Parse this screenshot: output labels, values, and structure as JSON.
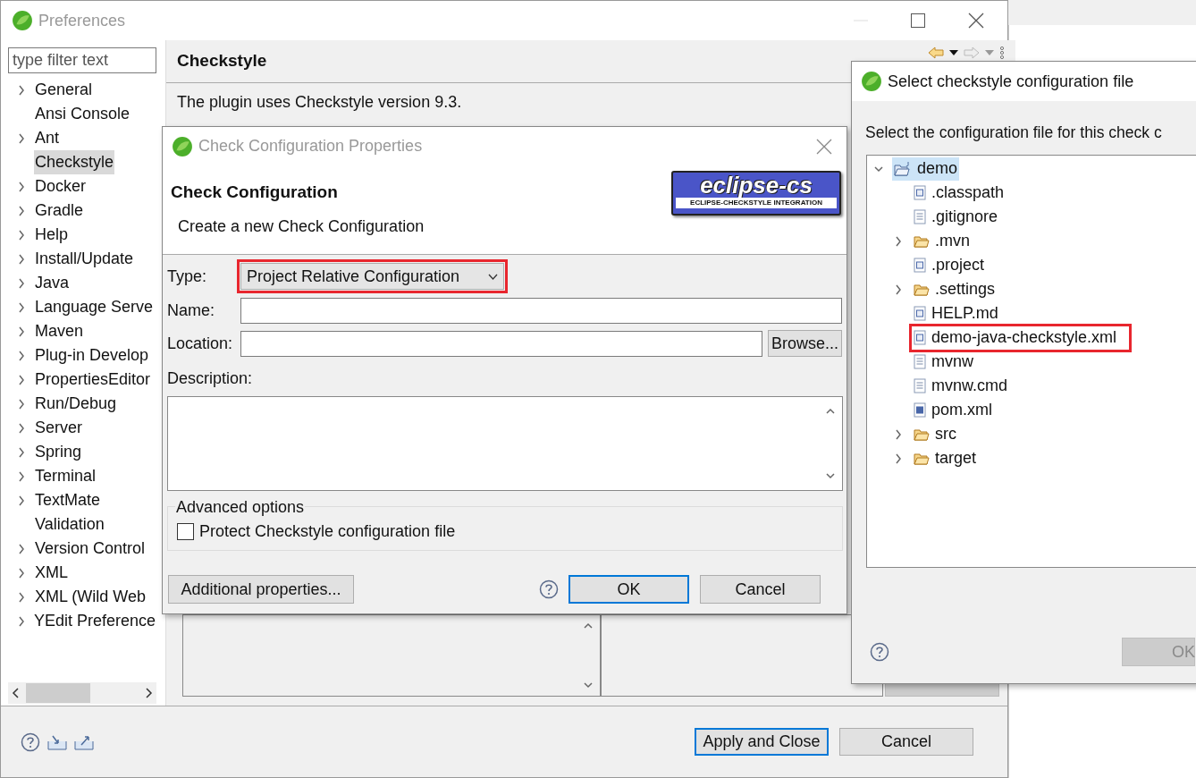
{
  "preferences": {
    "title": "Preferences",
    "filter": {
      "placeholder": "type filter text"
    },
    "tree": [
      {
        "label": "General",
        "expandable": true,
        "selected": false
      },
      {
        "label": "Ansi Console",
        "expandable": false,
        "selected": false
      },
      {
        "label": "Ant",
        "expandable": true,
        "selected": false
      },
      {
        "label": "Checkstyle",
        "expandable": false,
        "selected": true
      },
      {
        "label": "Docker",
        "expandable": true,
        "selected": false
      },
      {
        "label": "Gradle",
        "expandable": true,
        "selected": false
      },
      {
        "label": "Help",
        "expandable": true,
        "selected": false
      },
      {
        "label": "Install/Update",
        "expandable": true,
        "selected": false
      },
      {
        "label": "Java",
        "expandable": true,
        "selected": false
      },
      {
        "label": "Language Serve",
        "expandable": true,
        "selected": false
      },
      {
        "label": "Maven",
        "expandable": true,
        "selected": false
      },
      {
        "label": "Plug-in Develop",
        "expandable": true,
        "selected": false
      },
      {
        "label": "PropertiesEditor",
        "expandable": true,
        "selected": false
      },
      {
        "label": "Run/Debug",
        "expandable": true,
        "selected": false
      },
      {
        "label": "Server",
        "expandable": true,
        "selected": false
      },
      {
        "label": "Spring",
        "expandable": true,
        "selected": false
      },
      {
        "label": "Terminal",
        "expandable": true,
        "selected": false
      },
      {
        "label": "TextMate",
        "expandable": true,
        "selected": false
      },
      {
        "label": "Validation",
        "expandable": false,
        "selected": false
      },
      {
        "label": "Version Control",
        "expandable": true,
        "selected": false
      },
      {
        "label": "XML",
        "expandable": true,
        "selected": false
      },
      {
        "label": "XML (Wild Web",
        "expandable": true,
        "selected": false
      },
      {
        "label": "YEdit Preference",
        "expandable": true,
        "selected": false
      }
    ],
    "page": {
      "title": "Checkstyle",
      "version_text": "The plugin uses Checkstyle version 9.3."
    },
    "buttons": [
      {
        "label": "Apply and Close",
        "default": true
      },
      {
        "label": "Cancel",
        "default": false
      }
    ]
  },
  "check_config_dialog": {
    "title": "Check Configuration Properties",
    "heading": "Check Configuration",
    "subtitle": "Create a new Check Configuration",
    "logo": {
      "name": "eclipse-cs",
      "tagline": "ECLIPSE-CHECKSTYLE INTEGRATION"
    },
    "type": {
      "label": "Type:",
      "value": "Project Relative Configuration",
      "highlighted": true
    },
    "name": {
      "label": "Name:"
    },
    "location": {
      "label": "Location:"
    },
    "browse_button": "Browse...",
    "description": {
      "label": "Description:"
    },
    "advanced": {
      "legend": "Advanced options",
      "protect": {
        "label": "Protect Checkstyle configuration file",
        "checked": false
      }
    },
    "additional_button": "Additional properties...",
    "buttons": [
      {
        "label": "OK",
        "default": true
      },
      {
        "label": "Cancel",
        "default": false
      }
    ]
  },
  "select_file_dialog": {
    "title": "Select checkstyle configuration file",
    "prompt": "Select the configuration file for this check c",
    "tree": [
      {
        "label": "demo",
        "kind": "project",
        "expanded": true,
        "selected": true,
        "highlighted": false,
        "children": [
          {
            "label": ".classpath",
            "kind": "xml",
            "selected": false,
            "highlighted": false
          },
          {
            "label": ".gitignore",
            "kind": "text",
            "selected": false,
            "highlighted": false
          },
          {
            "label": ".mvn",
            "kind": "folder",
            "expanded": false,
            "selected": false,
            "highlighted": false
          },
          {
            "label": ".project",
            "kind": "xml",
            "selected": false,
            "highlighted": false
          },
          {
            "label": ".settings",
            "kind": "folder",
            "expanded": false,
            "selected": false,
            "highlighted": false
          },
          {
            "label": "HELP.md",
            "kind": "md",
            "selected": false,
            "highlighted": false
          },
          {
            "label": "demo-java-checkstyle.xml",
            "kind": "xml",
            "selected": false,
            "highlighted": true
          },
          {
            "label": "mvnw",
            "kind": "text",
            "selected": false,
            "highlighted": false
          },
          {
            "label": "mvnw.cmd",
            "kind": "text",
            "selected": false,
            "highlighted": false
          },
          {
            "label": "pom.xml",
            "kind": "maven",
            "selected": false,
            "highlighted": false
          },
          {
            "label": "src",
            "kind": "folder",
            "expanded": false,
            "selected": false,
            "highlighted": false
          },
          {
            "label": "target",
            "kind": "folder",
            "expanded": false,
            "selected": false,
            "highlighted": false
          }
        ]
      }
    ],
    "ok_button": {
      "label": "OK",
      "disabled": true
    }
  }
}
